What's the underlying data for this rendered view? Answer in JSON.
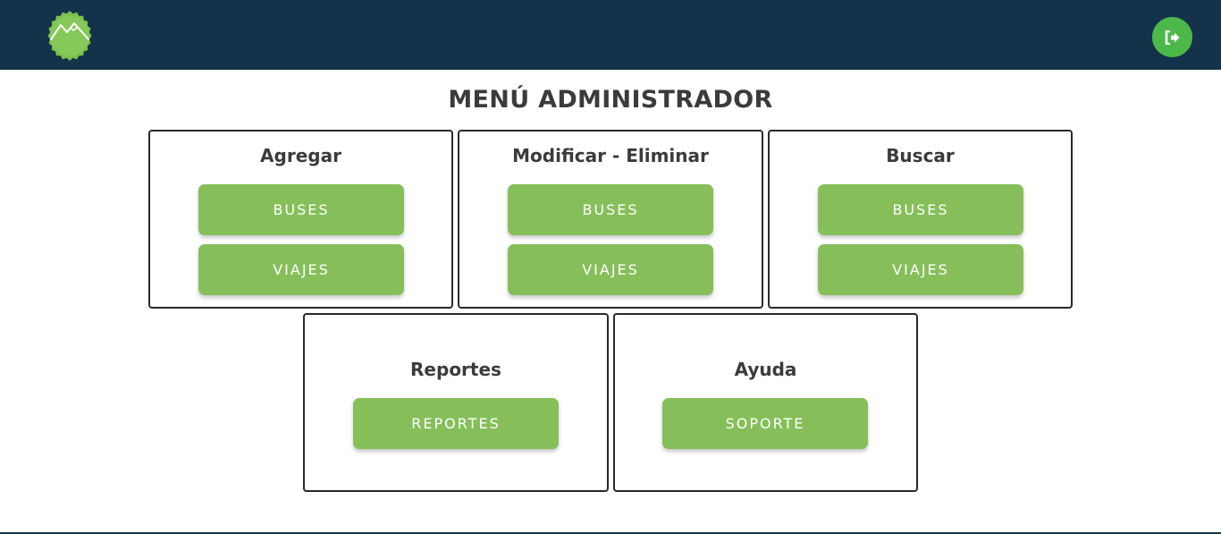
{
  "header": {
    "logo_icon": "mountain-badge-icon",
    "logout_icon": "sign-out-icon",
    "colors": {
      "navbar": "#14334a",
      "logout": "#4db84a",
      "logo": "#7cc14f"
    }
  },
  "page": {
    "title": "MENÚ ADMINISTRADOR"
  },
  "cards": {
    "agregar": {
      "title": "Agregar",
      "buttons": [
        "BUSES",
        "VIAJES"
      ]
    },
    "modificar": {
      "title": "Modificar - Eliminar",
      "buttons": [
        "BUSES",
        "VIAJES"
      ]
    },
    "buscar": {
      "title": "Buscar",
      "buttons": [
        "BUSES",
        "VIAJES"
      ]
    },
    "reportes": {
      "title": "Reportes",
      "buttons": [
        "REPORTES"
      ]
    },
    "ayuda": {
      "title": "Ayuda",
      "buttons": [
        "SOPORTE"
      ]
    }
  },
  "colors": {
    "button": "#86bf5a",
    "text": "#3b3b3b",
    "border": "#2a2a2a"
  }
}
